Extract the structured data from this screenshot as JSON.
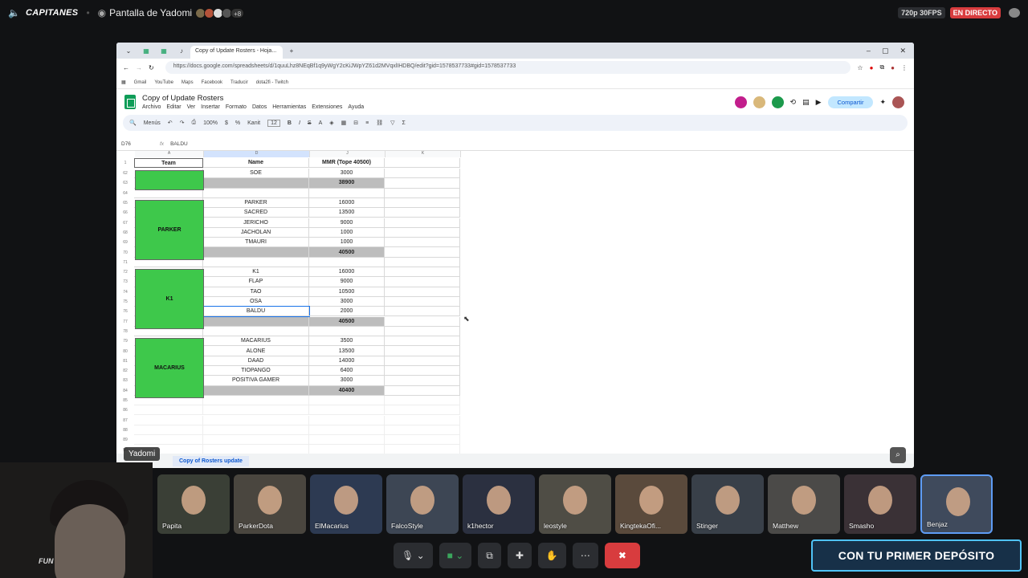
{
  "topbar": {
    "channel": "CAPITANES",
    "screen_label": "Pantalla de Yadomi",
    "more_count": "+8",
    "quality": "720p 30FPS",
    "live": "EN DIRECTO"
  },
  "browser": {
    "tab_title": "Copy of Update Rosters - Hoja...",
    "url": "https://docs.google.com/spreadsheets/d/1quuLhz8NEqBf1q9yWgY2cKiJWpYZ61d2MVqxlIHDBQ/edit?gid=1578537733#gid=1578537733",
    "bookmarks": [
      "Gmail",
      "YouTube",
      "Maps",
      "Facebook",
      "Traducir",
      "dota2fi - Twitch"
    ]
  },
  "sheet": {
    "title": "Copy of Update Rosters",
    "menu": [
      "Archivo",
      "Editar",
      "Ver",
      "Insertar",
      "Formato",
      "Datos",
      "Herramientas",
      "Extensiones",
      "Ayuda"
    ],
    "share": "Compartir",
    "toolbar": {
      "menus": "Menús",
      "zoom": "100%",
      "font": "Kanit",
      "size": "12"
    },
    "cell_ref": "D76",
    "formula_value": "BALDU",
    "columns": [
      "A",
      "D",
      "J",
      "K"
    ],
    "headers": {
      "team": "Team",
      "name": "Name",
      "mmr": "MMR (Tope 40500)"
    },
    "rows": [
      {
        "rn": "62",
        "name": "SOE",
        "mmr": "3000",
        "total": false
      },
      {
        "rn": "63",
        "name": "",
        "mmr": "38900",
        "total": true
      },
      {
        "rn": "64",
        "name": "",
        "mmr": "",
        "total": false
      },
      {
        "rn": "65",
        "name": "PARKER",
        "mmr": "16000",
        "total": false
      },
      {
        "rn": "66",
        "name": "SACRED",
        "mmr": "13500",
        "total": false
      },
      {
        "rn": "67",
        "name": "JERICHO",
        "mmr": "9000",
        "total": false
      },
      {
        "rn": "68",
        "name": "JACHOLAN",
        "mmr": "1000",
        "total": false
      },
      {
        "rn": "69",
        "name": "TMAURI",
        "mmr": "1000",
        "total": false
      },
      {
        "rn": "70",
        "name": "",
        "mmr": "40500",
        "total": true
      },
      {
        "rn": "71",
        "name": "",
        "mmr": "",
        "total": false
      },
      {
        "rn": "72",
        "name": "K1",
        "mmr": "16000",
        "total": false
      },
      {
        "rn": "73",
        "name": "FLAP",
        "mmr": "9000",
        "total": false
      },
      {
        "rn": "74",
        "name": "TAO",
        "mmr": "10500",
        "total": false
      },
      {
        "rn": "75",
        "name": "OSA",
        "mmr": "3000",
        "total": false
      },
      {
        "rn": "76",
        "name": "BALDU",
        "mmr": "2000",
        "total": false
      },
      {
        "rn": "77",
        "name": "",
        "mmr": "40500",
        "total": true
      },
      {
        "rn": "78",
        "name": "",
        "mmr": "",
        "total": false
      },
      {
        "rn": "79",
        "name": "MACARIUS",
        "mmr": "3500",
        "total": false
      },
      {
        "rn": "80",
        "name": "ALONE",
        "mmr": "13500",
        "total": false
      },
      {
        "rn": "81",
        "name": "DAAD",
        "mmr": "14000",
        "total": false
      },
      {
        "rn": "82",
        "name": "TIOPANGO",
        "mmr": "6400",
        "total": false
      },
      {
        "rn": "83",
        "name": "POSITIVA GAMER",
        "mmr": "3000",
        "total": false
      },
      {
        "rn": "84",
        "name": "",
        "mmr": "40400",
        "total": true
      },
      {
        "rn": "85",
        "name": "",
        "mmr": "",
        "total": false
      },
      {
        "rn": "86",
        "name": "",
        "mmr": "",
        "total": false
      },
      {
        "rn": "87",
        "name": "",
        "mmr": "",
        "total": false
      },
      {
        "rn": "88",
        "name": "",
        "mmr": "",
        "total": false
      },
      {
        "rn": "89",
        "name": "",
        "mmr": "",
        "total": false
      },
      {
        "rn": "90",
        "name": "",
        "mmr": "",
        "total": false
      }
    ],
    "teams": [
      "PARKER",
      "K1",
      "MACARIUS"
    ],
    "sheet_tab": "Copy of Rosters update"
  },
  "overlay_name": "Yadomi",
  "participants": [
    "Papita",
    "ParkerDota",
    "ElMacarius",
    "FalcoStyle",
    "k1hector",
    "leostyle",
    "KingtekaOfi...",
    "Stinger",
    "Matthew",
    "Smasho",
    "Benjaz"
  ],
  "promo": "CON TU PRIMER DEPÓSITO",
  "colors": {
    "team_green": "#3ec84b",
    "total_gray": "#bdbdbd",
    "live_red": "#d83c3e"
  }
}
